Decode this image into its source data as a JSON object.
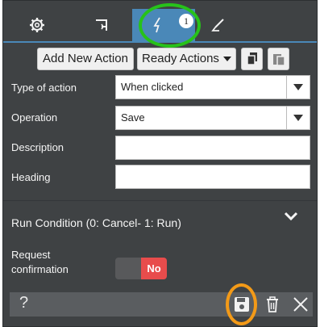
{
  "tabs": [
    {
      "name": "settings",
      "icon": "gear-icon"
    },
    {
      "name": "label",
      "icon": "flag-icon"
    },
    {
      "name": "actions",
      "icon": "lightning-icon",
      "active": true,
      "badge": "1"
    },
    {
      "name": "style",
      "icon": "brush-icon"
    }
  ],
  "toolbar": {
    "add_action": "Add New Action",
    "ready_actions": "Ready Actions",
    "copy_icon": "copy-icon",
    "paste_icon": "paste-icon"
  },
  "form": {
    "type_label": "Type of action",
    "type_value": "When clicked",
    "operation_label": "Operation",
    "operation_value": "Save",
    "description_label": "Description",
    "description_value": "",
    "heading_label": "Heading",
    "heading_value": ""
  },
  "run_condition": {
    "label": "Run Condition (0: Cancel- 1: Run)",
    "chevron_icon": "chevron-down-icon"
  },
  "confirmation": {
    "label_line1": "Request",
    "label_line2": "confirmation",
    "toggle_value": "No"
  },
  "footer": {
    "help": "?",
    "save_icon": "floppy-disk-icon",
    "delete_icon": "trash-icon",
    "close_icon": "close-icon"
  },
  "colors": {
    "panel": "#3f4244",
    "active_tab": "#4a88b8",
    "toggle_no": "#e84c4c",
    "highlight_green": "#27c21a",
    "highlight_orange": "#f39a18"
  }
}
